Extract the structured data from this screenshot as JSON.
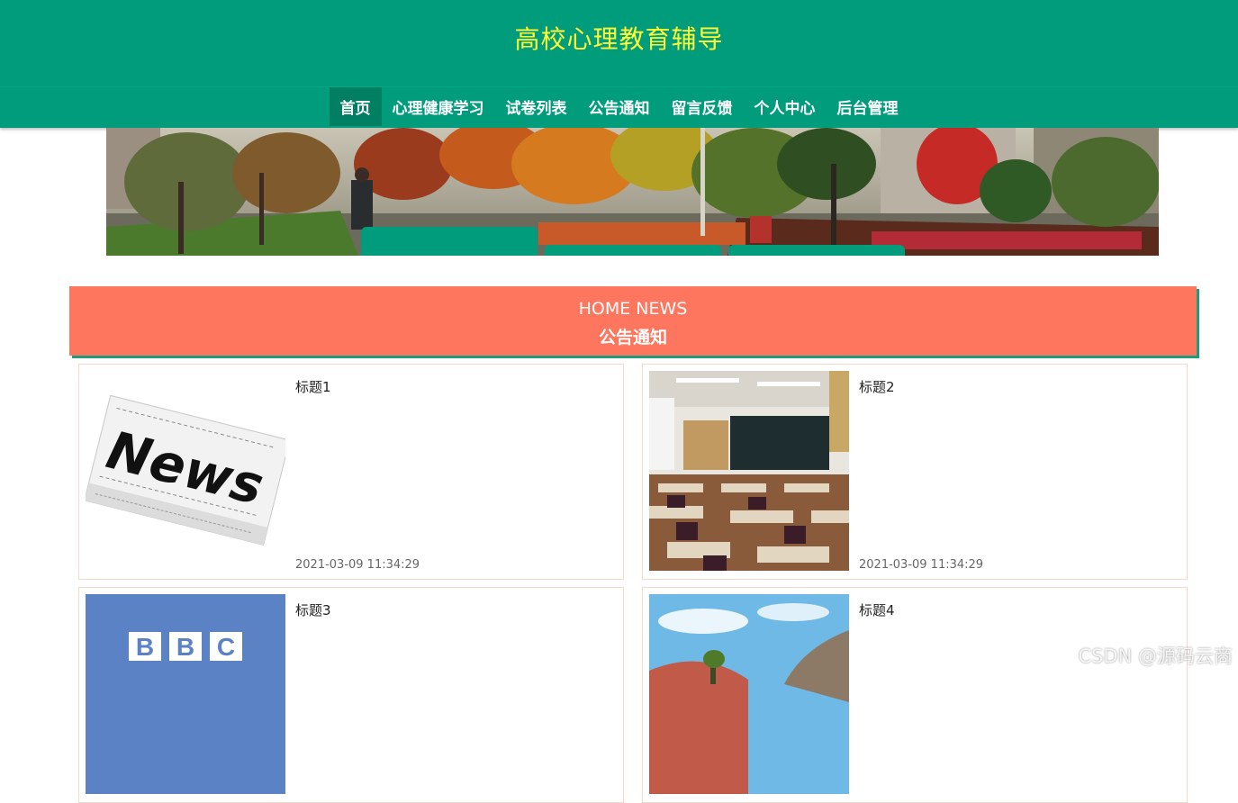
{
  "site": {
    "title": "高校心理教育辅导"
  },
  "nav": {
    "items": [
      {
        "label": "首页",
        "active": true
      },
      {
        "label": "心理健康学习",
        "active": false
      },
      {
        "label": "试卷列表",
        "active": false
      },
      {
        "label": "公告通知",
        "active": false
      },
      {
        "label": "留言反馈",
        "active": false
      },
      {
        "label": "个人中心",
        "active": false
      },
      {
        "label": "后台管理",
        "active": false
      }
    ]
  },
  "news_section": {
    "title_en": "HOME NEWS",
    "title_cn": "公告通知"
  },
  "news": [
    {
      "title": "标题1",
      "date": "2021-03-09 11:34:29",
      "thumb": "news-newspaper-image"
    },
    {
      "title": "标题2",
      "date": "2021-03-09 11:34:29",
      "thumb": "classroom-image"
    },
    {
      "title": "标题3",
      "date": "",
      "thumb": "bbc-logo-image",
      "thumb_text": "BBC"
    },
    {
      "title": "标题4",
      "date": "",
      "thumb": "sky-building-image"
    }
  ],
  "watermark": "CSDN @源码云商",
  "colors": {
    "header": "#009c7c",
    "title": "#ffff33",
    "news_bar": "#fd765d",
    "card_border": "#f7d8cc"
  }
}
